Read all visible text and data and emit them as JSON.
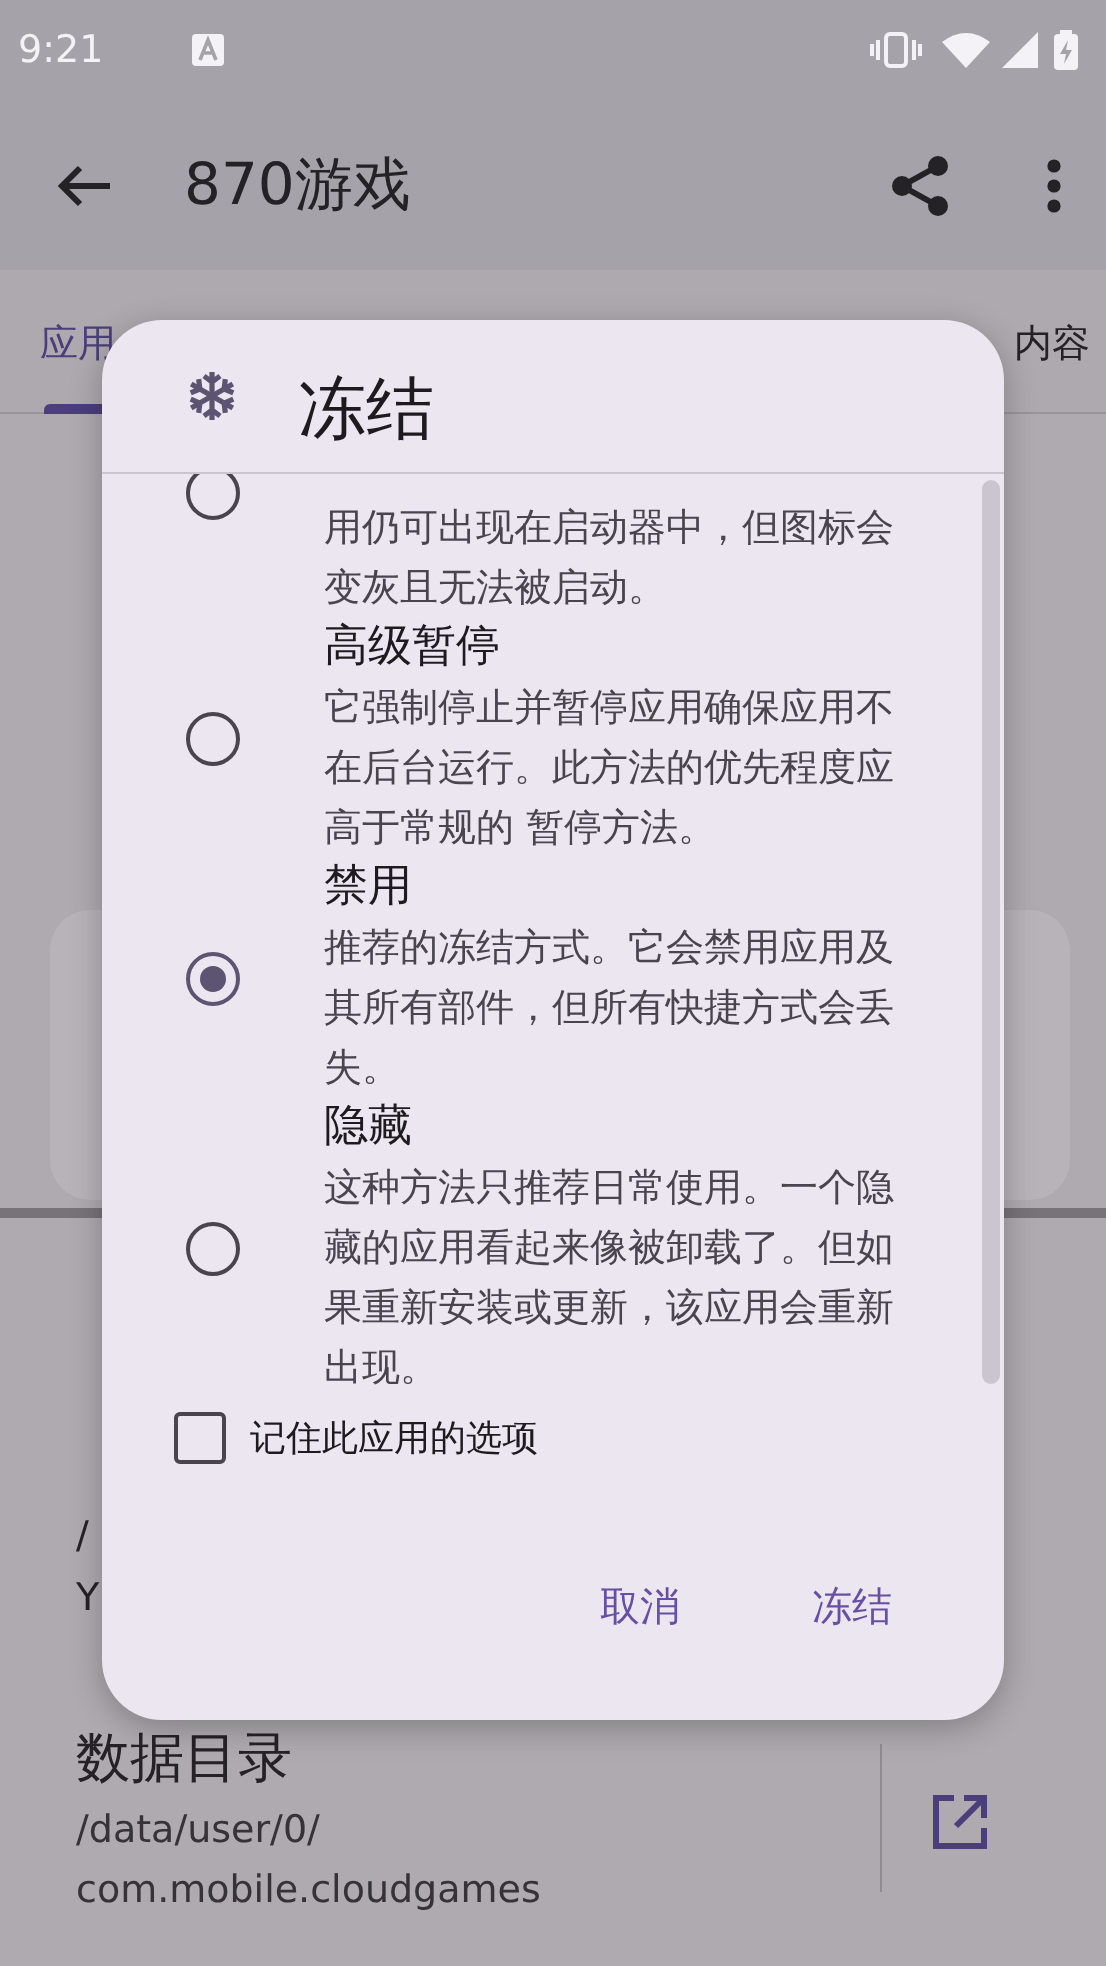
{
  "status_bar": {
    "time": "9:21"
  },
  "app_bar": {
    "title": "870游戏"
  },
  "tabs": [
    {
      "label": "应用",
      "selected": true
    },
    {
      "label": "内容",
      "selected": false
    }
  ],
  "background_lines": [
    {
      "kind": "subtitle",
      "text": "/"
    },
    {
      "kind": "subtitle",
      "text": "Y"
    }
  ],
  "data_directory": {
    "title": "数据目录",
    "path": [
      "/data/user/0/",
      "com.mobile.cloudgames"
    ]
  },
  "dialog": {
    "title": "冻结",
    "options": [
      {
        "description": "用仍可出现在启动器中，但图标会变灰且无法被启动。",
        "selected": false
      },
      {
        "title": "高级暂停",
        "description": "它强制停止并暂停应用确保应用不在后台运行。此方法的优先程度应高于常规的 暂停方法。",
        "selected": false
      },
      {
        "title": "禁用",
        "description": "推荐的冻结方式。它会禁用应用及其所有部件，但所有快捷方式会丢失。",
        "selected": true
      },
      {
        "title": "隐藏",
        "description": "这种方法只推荐日常使用。一个隐藏的应用看起来像被卸载了。但如果重新安装或更新，该应用会重新出现。",
        "selected": false
      }
    ],
    "remember": {
      "label": "记住此应用的选项",
      "checked": false
    },
    "buttons": [
      "取消",
      "冻结"
    ]
  }
}
